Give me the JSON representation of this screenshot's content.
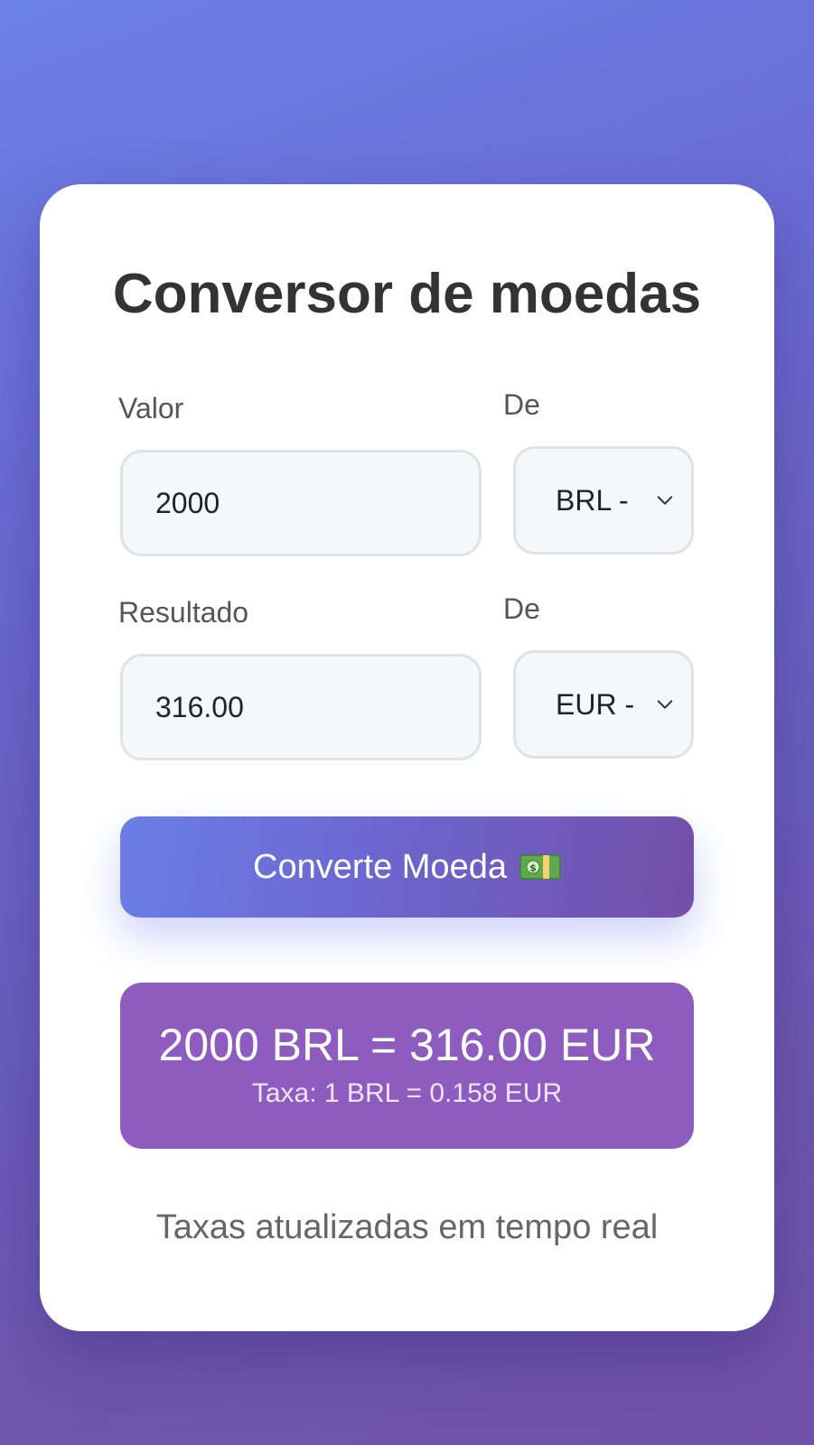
{
  "converter": {
    "title": "Conversor de moedas",
    "amount": {
      "label": "Valor",
      "value": "2000"
    },
    "from_currency": {
      "label": "De",
      "selected": "BRL -"
    },
    "result": {
      "label": "Resultado",
      "value": "316.00"
    },
    "to_currency": {
      "label": "De",
      "selected": "EUR -"
    },
    "convert_button": {
      "label": "Converte Moeda",
      "icon": "money-bill-icon"
    },
    "summary": {
      "main": "2000 BRL = 316.00 EUR",
      "rate": "Taxa: 1 BRL = 0.158 EUR"
    },
    "footer": "Taxas atualizadas em tempo real"
  },
  "colors": {
    "background_start": "#6b82e8",
    "background_end": "#7251a8",
    "button_start": "#6a7fe6",
    "button_end": "#744fa8",
    "result_box": "#8e5bbf",
    "title_text": "#333333"
  }
}
